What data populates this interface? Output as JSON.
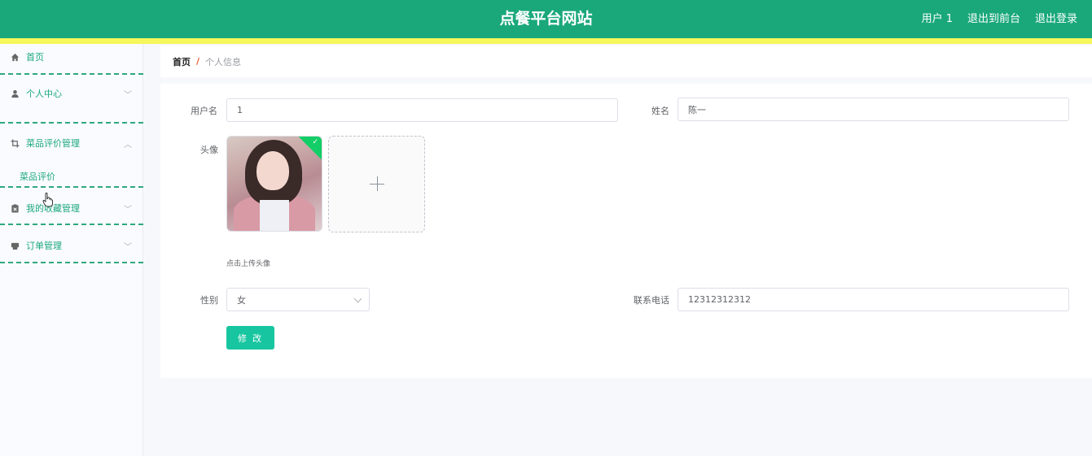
{
  "header": {
    "title": "点餐平台网站",
    "user": "用户 1",
    "back_to_front": "退出到前台",
    "logout": "退出登录"
  },
  "sidebar": {
    "items": [
      {
        "label": "首页",
        "icon": "home-icon"
      },
      {
        "label": "个人中心",
        "icon": "user-icon"
      },
      {
        "label": "菜品评价管理",
        "icon": "crop-icon"
      },
      {
        "label": "我的收藏管理",
        "icon": "clipboard-x-icon"
      },
      {
        "label": "订单管理",
        "icon": "printer-icon"
      }
    ],
    "sub_items": [
      {
        "label": "菜品评价"
      }
    ]
  },
  "breadcrumb": {
    "home": "首页",
    "separator": "/",
    "current": "个人信息"
  },
  "form": {
    "username_label": "用户名",
    "username_value": "1",
    "name_label": "姓名",
    "name_value": "陈一",
    "avatar_label": "头像",
    "avatar_hint": "点击上传头像",
    "gender_label": "性别",
    "gender_value": "女",
    "phone_label": "联系电话",
    "phone_value": "12312312312",
    "submit_label": "修 改"
  },
  "colors": {
    "primary": "#1aa87a",
    "accent_bar": "#f5f75a",
    "button": "#17c6a0"
  }
}
